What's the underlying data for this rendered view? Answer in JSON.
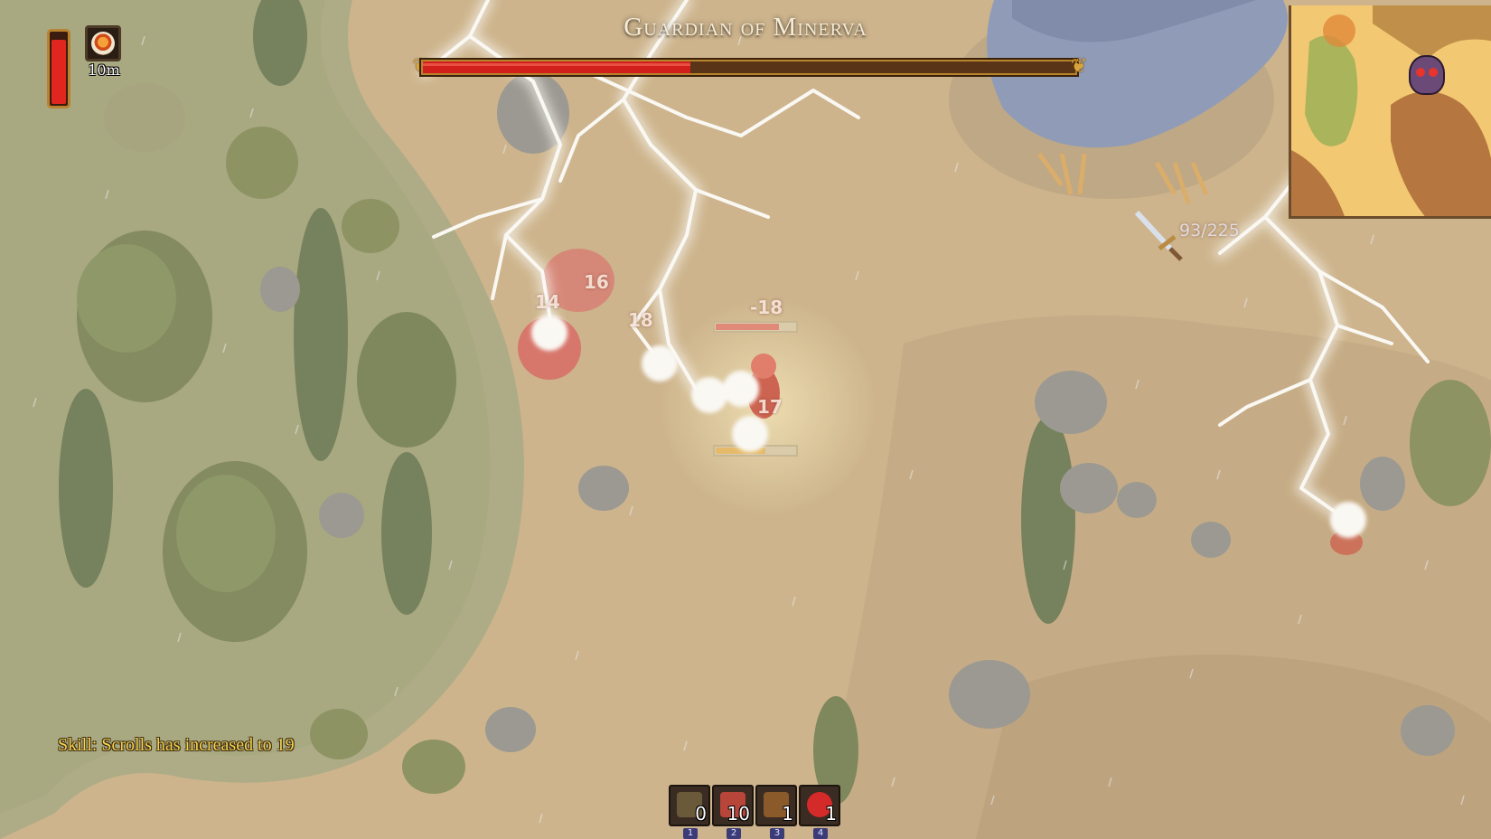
{
  "boss": {
    "name": "Guardian of Minerva",
    "health_fraction": 0.41
  },
  "player": {
    "health_fraction": 0.92,
    "food_buff_icon": "food-bowl-icon",
    "food_buff_timer": "10m"
  },
  "weapon": {
    "icon": "sword-icon",
    "durability_text": "93/225"
  },
  "floating_numbers": {
    "hit_1": "14",
    "hit_2": "16",
    "hit_3": "-18",
    "hit_4": "18",
    "hit_5": "17"
  },
  "notification": {
    "text": "Skill: Scrolls has increased to 19"
  },
  "hotbar": {
    "slots": [
      {
        "icon": "chest-icon",
        "count": "0",
        "key": "1",
        "color": "#6b5a3a"
      },
      {
        "icon": "meat-icon",
        "count": "10",
        "key": "2",
        "color": "#b8453a"
      },
      {
        "icon": "seeds-icon",
        "count": "1",
        "key": "3",
        "color": "#8a5a2a"
      },
      {
        "icon": "health-potion-icon",
        "count": "1",
        "key": "4",
        "color": "#d42a2a"
      }
    ]
  },
  "minimap": {
    "boss_marker_icon": "owl-boss-icon"
  },
  "colors": {
    "boss_health": "#d1201b",
    "notification": "#f4d24e",
    "frame_gold": "#b8852d"
  }
}
